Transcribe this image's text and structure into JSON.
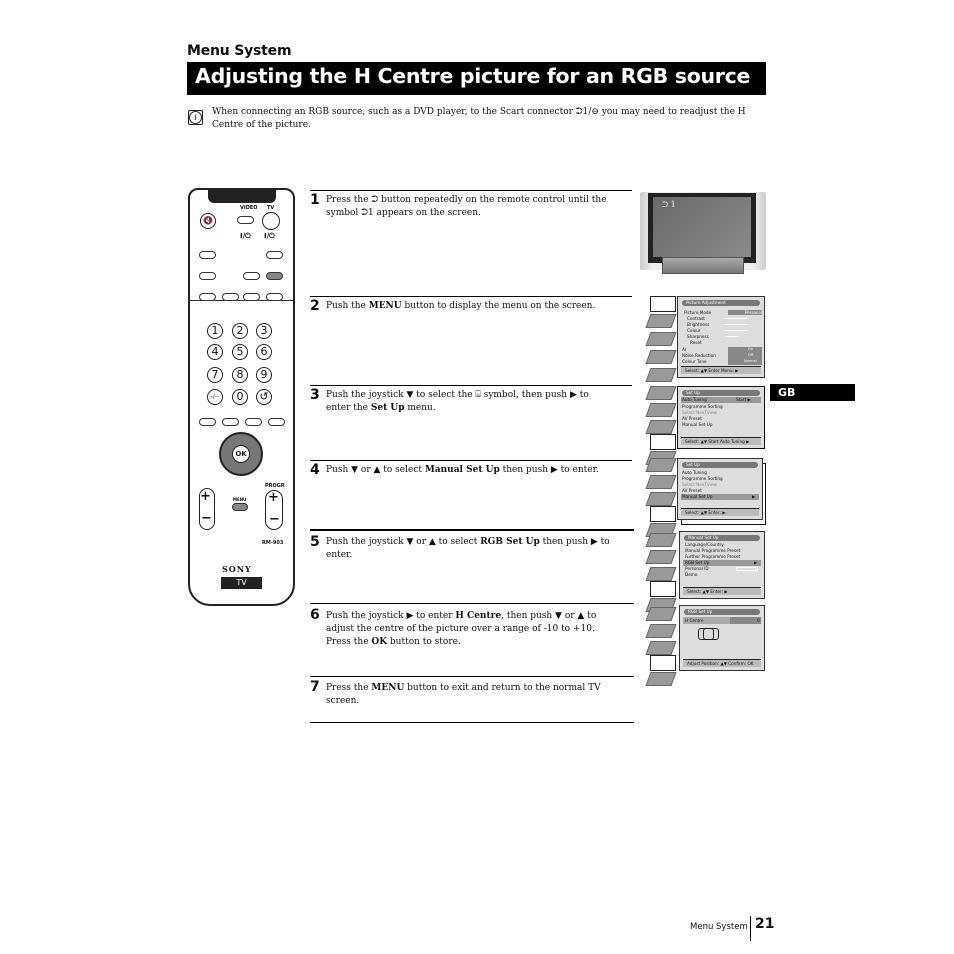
{
  "header": {
    "section": "Menu System",
    "title": "Adjusting the H Centre picture for an RGB source"
  },
  "intro": {
    "icon": "info-icon",
    "text": "When connecting an RGB source, such as a DVD player, to the Scart connector ⮊1/⊖ you may need to readjust the H Centre of the picture."
  },
  "side_tab": "GB",
  "steps": [
    {
      "num": "1",
      "html_parts": [
        "Press the ",
        "⮊",
        " button repeatedly on the remote control until the symbol ",
        "⮊1",
        " appears on the screen."
      ]
    },
    {
      "num": "2",
      "pre": "Push the ",
      "bold": "MENU",
      "post": " button to display the menu on the screen."
    },
    {
      "num": "3",
      "pre": "Push the joystick ▼ to select the ⌸ symbol, then push ▶ to enter the ",
      "bold": "Set Up",
      "post": " menu."
    },
    {
      "num": "4",
      "pre": "Push ▼ or ▲ to select ",
      "bold": "Manual Set Up",
      "post": " then push ▶ to enter."
    },
    {
      "num": "5",
      "pre": "Push the joystick ▼ or ▲ to select ",
      "bold": "RGB Set Up",
      "post": " then push ▶ to enter."
    },
    {
      "num": "6",
      "pre": "Push the joystick ▶ to enter ",
      "bold": "H Centre",
      "mid": ", then push ▼ or ▲ to adjust the centre of the picture over a range of -10 to +10. Press the ",
      "bold2": "OK",
      "post": " button to store."
    },
    {
      "num": "7",
      "pre": "Press the ",
      "bold": "MENU",
      "post": " button to exit and return to the normal TV screen."
    }
  ],
  "step1": {
    "pre": "Press the ",
    "icon1": "⮊",
    "mid": " button repeatedly on the remote control until the symbol ",
    "icon2": "⮊1",
    "post": " appears on the screen."
  },
  "remote": {
    "video_label": "VIDEO",
    "tv_label": "TV",
    "power_label": "I/⏻",
    "digits": [
      "1",
      "2",
      "3",
      "4",
      "5",
      "6",
      "7",
      "8",
      "9",
      "-/--",
      "0",
      "↺"
    ],
    "ok_label": "OK",
    "menu_label": "MENU",
    "progr_label": "PROGR",
    "model": "RM-903",
    "brand": "SONY",
    "tv_badge": "TV"
  },
  "tv_screen": {
    "osd": "⮊ 1"
  },
  "osd_picture": {
    "header": "Picture Adjustment",
    "rows": [
      "Picture Mode",
      "Contrast",
      "Brightness",
      "Colour",
      "Sharpness",
      "Reset",
      "AI",
      "Noise Reduction",
      "Colour Tone"
    ],
    "mode_value": "Personal",
    "ai_value": "On",
    "nr_value": "Off",
    "tone_value": "Normal",
    "footer": "Select: ▲▼  Enter Menu: ▶"
  },
  "osd_setup1": {
    "header": "Set Up",
    "rows": [
      "Auto Tuning",
      "Programme Sorting",
      "Select NexTView",
      "AV Preset",
      "Manual Set Up"
    ],
    "start": "Start ▶",
    "footer": "Select: ▲▼  Start Auto Tuning ▶"
  },
  "osd_setup2": {
    "header": "Set Up",
    "rows": [
      "Auto Tuning",
      "Programme Sorting",
      "Select NexTView",
      "AV Preset",
      "Manual Set Up"
    ],
    "footer": "Select: ▲▼  Enter: ▶"
  },
  "osd_manual": {
    "header": "Manual Set Up",
    "rows": [
      "Language/Country",
      "Manual Programme Preset",
      "Further Programme Preset",
      "RGB Set Up",
      "Personal ID",
      "Demo"
    ],
    "footer": "Select: ▲▼  Enter: ▶"
  },
  "osd_rgb": {
    "header": "RGB Set Up",
    "row": "H Centre",
    "value": "0",
    "footer": "Adjust Position: ▲▼  Confirm: OK"
  },
  "footer": {
    "label": "Menu System",
    "page": "21"
  }
}
